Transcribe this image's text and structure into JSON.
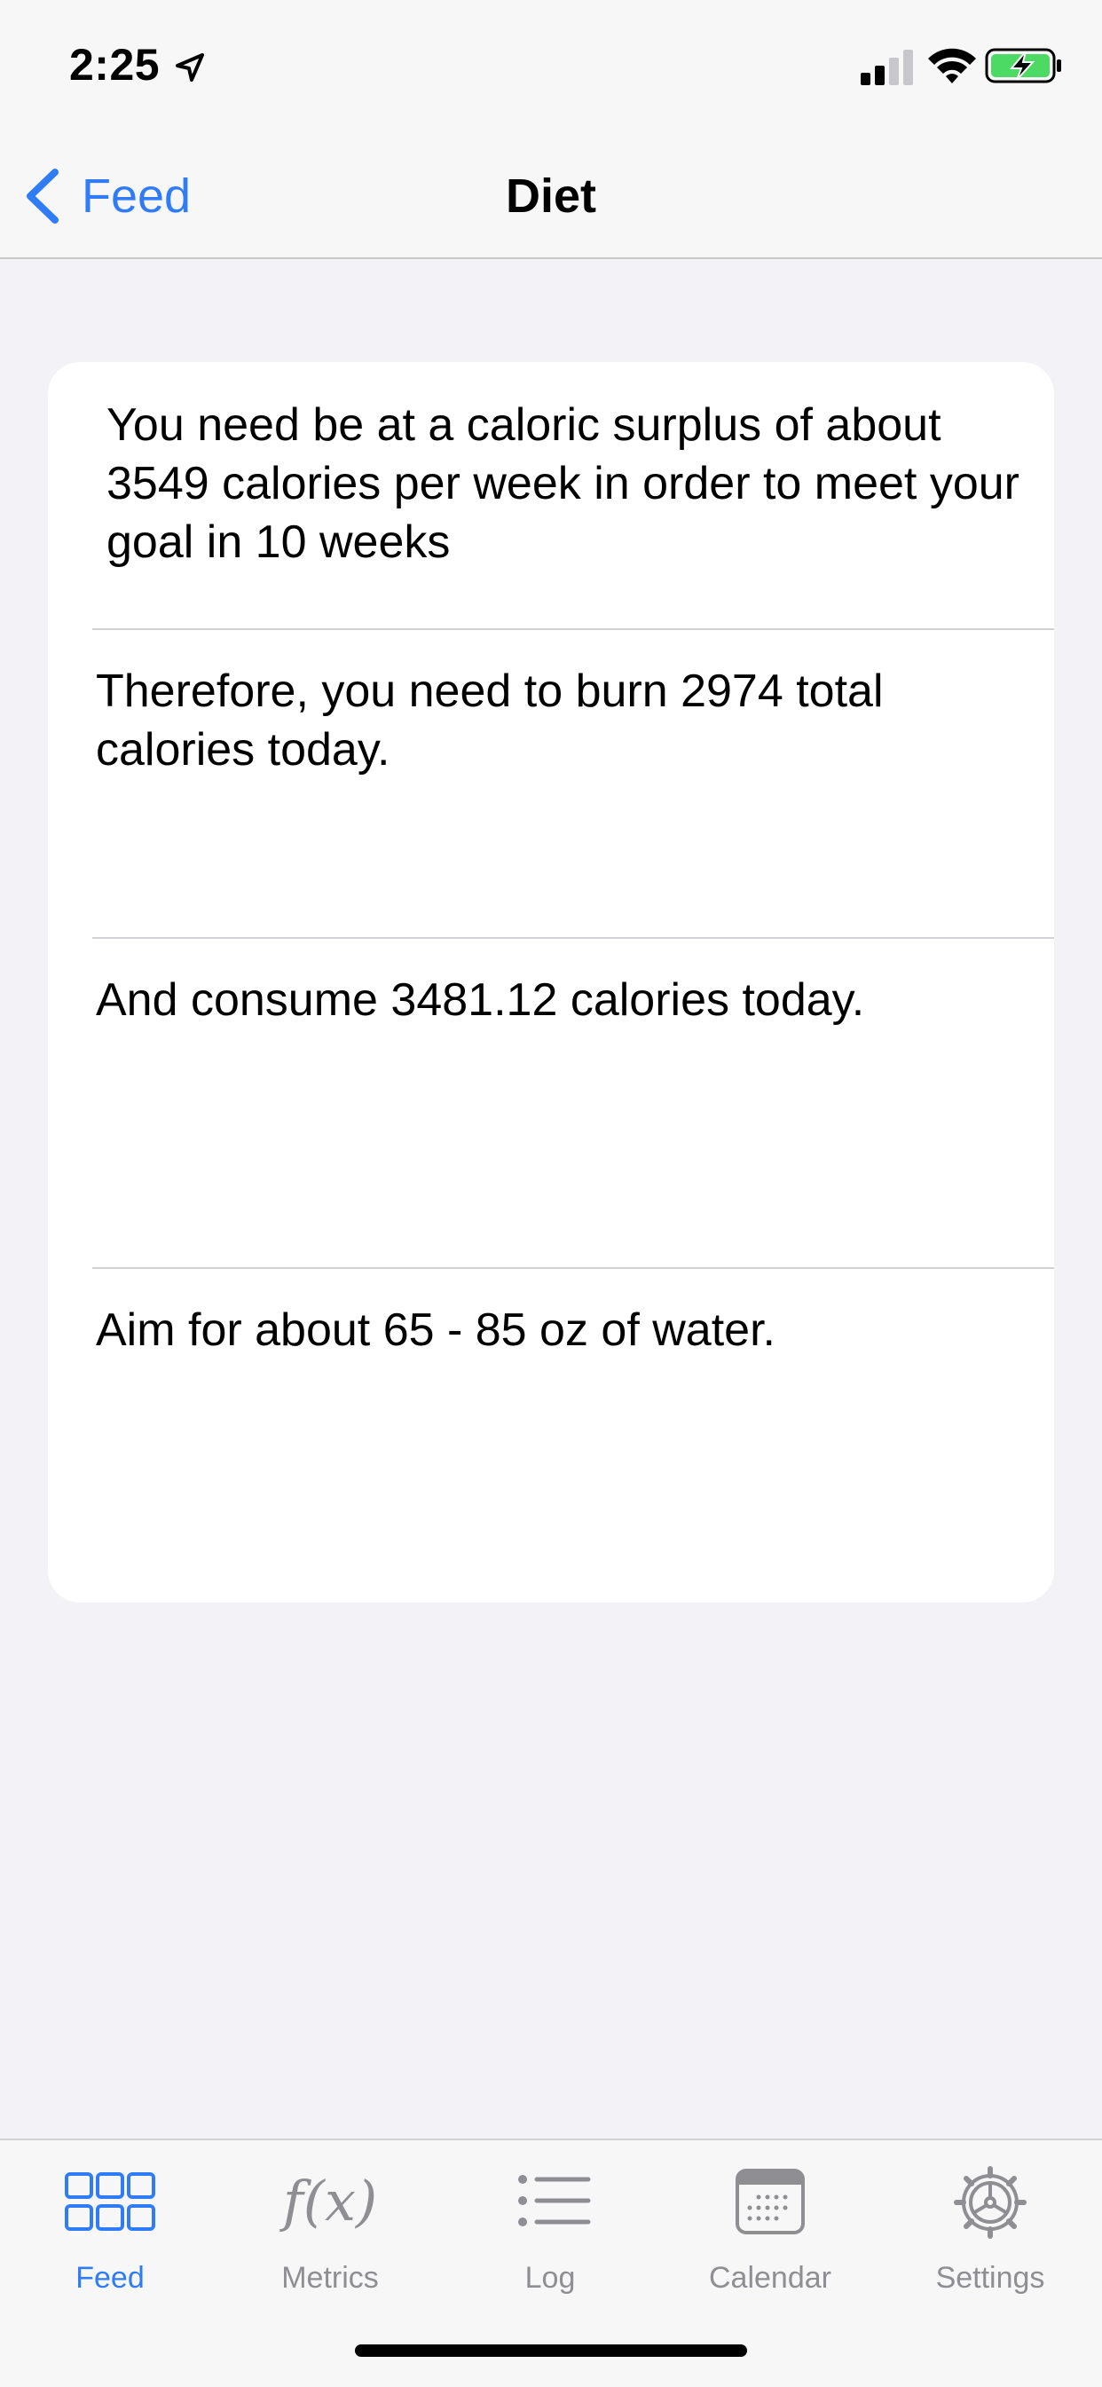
{
  "status_bar": {
    "time": "2:25"
  },
  "nav": {
    "back_label": "Feed",
    "title": "Diet"
  },
  "card": {
    "rows": [
      {
        "text": "You need be at a caloric surplus of about 3549 calories per week in order to meet your goal in 10 weeks"
      },
      {
        "text": "Therefore, you need to burn 2974 total calories today."
      },
      {
        "text": "And consume 3481.12 calories today."
      },
      {
        "text": "Aim for about 65 - 85 oz of water."
      }
    ]
  },
  "tabs": [
    {
      "label": "Feed",
      "icon": "grid-icon",
      "active": true
    },
    {
      "label": "Metrics",
      "icon": "function-icon",
      "glyph": "f(x)",
      "active": false
    },
    {
      "label": "Log",
      "icon": "list-icon",
      "active": false
    },
    {
      "label": "Calendar",
      "icon": "calendar-icon",
      "active": false
    },
    {
      "label": "Settings",
      "icon": "gear-icon",
      "active": false
    }
  ],
  "colors": {
    "accent": "#2f7cf6",
    "inactive": "#8e8e93",
    "background": "#f2f2f7",
    "battery_fill": "#4cd964"
  }
}
